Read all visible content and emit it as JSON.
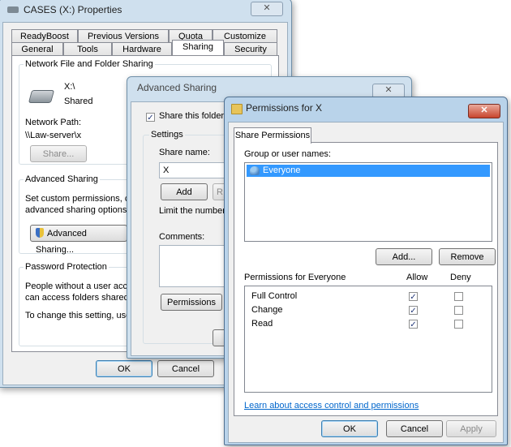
{
  "props": {
    "title": "CASES (X:) Properties",
    "close": "✕",
    "tabs_row1": [
      "ReadyBoost",
      "Previous Versions",
      "Quota",
      "Customize"
    ],
    "tabs_row2": [
      "General",
      "Tools",
      "Hardware",
      "Sharing",
      "Security"
    ],
    "nfs_group": "Network File and Folder Sharing",
    "drive_name": "X:\\",
    "drive_status": "Shared",
    "network_path_label": "Network Path:",
    "network_path": "\\\\Law-server\\x",
    "share_button": "Share...",
    "adv_group": "Advanced Sharing",
    "adv_desc1": "Set custom permissions, cre",
    "adv_desc2": "advanced sharing options.",
    "adv_button": "Advanced Sharing...",
    "pw_group": "Password Protection",
    "pw_desc1": "People without a user acco",
    "pw_desc2": "can access folders shared v",
    "pw_desc3": "To change this setting, use",
    "ok": "OK",
    "cancel": "Cancel"
  },
  "adv": {
    "title": "Advanced Sharing",
    "close": "✕",
    "share_folder": "Share this folder",
    "settings_label": "Settings",
    "share_name_label": "Share name:",
    "share_name_value": "X",
    "add": "Add",
    "remove_partial": "R",
    "limit_label": "Limit the number",
    "comments_label": "Comments:",
    "permissions_button": "Permissions"
  },
  "perm": {
    "title": "Permissions for X",
    "close": "✕",
    "tab": "Share Permissions",
    "group_label": "Group or user names:",
    "users": [
      "Everyone"
    ],
    "add": "Add...",
    "remove": "Remove",
    "perm_label": "Permissions for Everyone",
    "allow_header": "Allow",
    "deny_header": "Deny",
    "rows": [
      {
        "name": "Full Control",
        "allow": true,
        "deny": false
      },
      {
        "name": "Change",
        "allow": true,
        "deny": false
      },
      {
        "name": "Read",
        "allow": true,
        "deny": false
      }
    ],
    "link": "Learn about access control and permissions",
    "ok": "OK",
    "cancel": "Cancel",
    "apply": "Apply"
  }
}
